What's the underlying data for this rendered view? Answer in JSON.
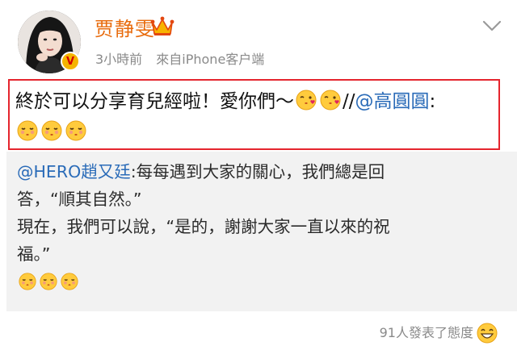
{
  "header": {
    "username": "贾静雯",
    "verified_badge": "V",
    "timestamp": "3小時前",
    "source": "來自iPhone客户端",
    "crown_icon": "vip-crown-icon",
    "menu_icon": "chevron-down-icon"
  },
  "post": {
    "text": "終於可以分享育兒經啦！愛你們～",
    "repost_separator": "//",
    "mention": "@高圓圓",
    "colon": ":",
    "emojis_inline": [
      "kiss-emoji",
      "kiss-emoji"
    ],
    "emojis_second_line": [
      "kiss-closed-eyes-emoji",
      "kiss-closed-eyes-emoji",
      "kiss-closed-eyes-emoji"
    ]
  },
  "repost": {
    "mention": "@HERO趙又廷",
    "line1": ":每每遇到大家的關心，我們總是回",
    "line2": "答，“順其自然。”",
    "line3": "現在，我們可以說，“是的，謝謝大家一直以來的祝",
    "line4": "福。”",
    "emojis": [
      "kiss-closed-eyes-emoji",
      "kiss-closed-eyes-emoji",
      "kiss-closed-eyes-emoji"
    ]
  },
  "footer": {
    "reactions_text": "91人發表了態度",
    "reaction_icon": "grin-emoji"
  },
  "colors": {
    "username": "#e86b0c",
    "mention": "#2a6bb8",
    "highlight_border": "#e5252e",
    "repost_bg": "#f2f2f2",
    "meta": "#8a8a8a"
  }
}
